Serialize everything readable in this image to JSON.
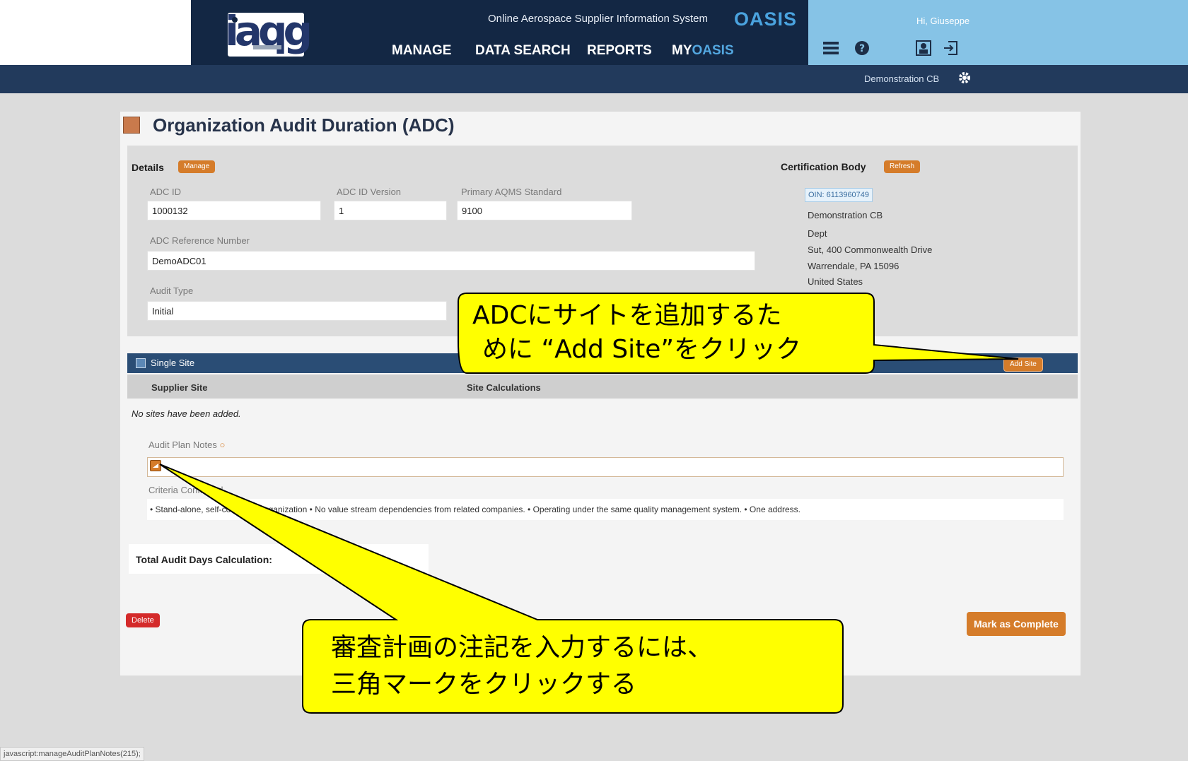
{
  "header": {
    "system_name": "Online Aerospace Supplier Information System",
    "system_short": "OASIS",
    "logo_text": "iaqg",
    "nav": {
      "manage": "MANAGE",
      "data_search": "DATA SEARCH",
      "reports": "REPORTS",
      "my_prefix": "MY",
      "my_suffix": "OASIS"
    },
    "greeting": "Hi, Giuseppe",
    "icons": [
      "menu-icon",
      "help-icon",
      "profile-icon",
      "logout-icon"
    ],
    "cb_name": "Demonstration CB",
    "colors": {
      "navy": "#132744",
      "light_blue": "#86c3e6",
      "accent": "#d57c2a"
    }
  },
  "page": {
    "title": "Organization Audit Duration (ADC)"
  },
  "details": {
    "label": "Details",
    "manage_button": "Manage",
    "adc_id_label": "ADC ID",
    "adc_id": "1000132",
    "adc_id_version_label": "ADC ID Version",
    "adc_id_version": "1",
    "primary_standard_label": "Primary AQMS Standard",
    "primary_standard": "9100",
    "reference_label": "ADC Reference Number",
    "reference": "DemoADC01",
    "audit_type_label": "Audit Type",
    "audit_type": "Initial"
  },
  "certification_body": {
    "label": "Certification Body",
    "refresh_button": "Refresh",
    "oin": "OIN: 6113960749",
    "name": "Demonstration CB",
    "dept": "Dept",
    "address1": "Sut, 400 Commonwealth Drive",
    "address2": "Warrendale, PA 15096",
    "country": "United States"
  },
  "site_section": {
    "title": "Single Site",
    "add_site_button": "Add Site",
    "col_supplier": "Supplier Site",
    "col_calc": "Site Calculations",
    "empty_message": "No sites have been added.",
    "notes_label": "Audit Plan Notes",
    "criteria_label": "Criteria Confirmed",
    "criteria_text": "• Stand-alone, self-contained organization • No value stream dependencies from related companies. • Operating under the same quality management system. • One address."
  },
  "totals": {
    "label": "Total Audit Days Calculation:"
  },
  "actions": {
    "delete": "Delete",
    "complete": "Mark as Complete"
  },
  "status_bar": "javascript:manageAuditPlanNotes(215);",
  "callouts": {
    "add_site_line1": "ADCにサイトを追加するた",
    "add_site_line2": "めに “Add Site”をクリック",
    "notes_line1": "審査計画の注記を入力するには、",
    "notes_line2": "三角マークをクリックする",
    "fill": "#ffff00"
  }
}
